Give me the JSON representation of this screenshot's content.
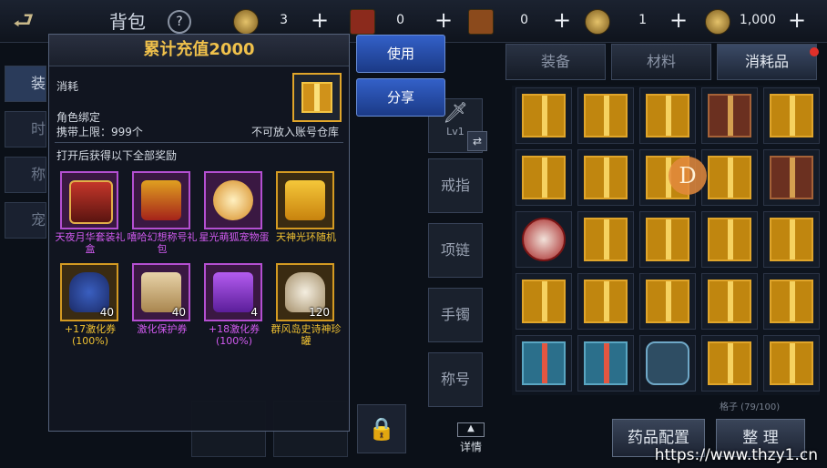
{
  "header": {
    "title": "背包",
    "currencies": [
      {
        "icon": "coin-icon",
        "value": "3"
      },
      {
        "icon": "scroll-icon",
        "value": "0"
      },
      {
        "icon": "ticket-icon",
        "value": "0"
      },
      {
        "icon": "gold-coin-icon",
        "value": "1"
      },
      {
        "icon": "gem-coin-icon",
        "value": "1,000"
      }
    ]
  },
  "inventory": {
    "tabs": [
      "装备",
      "材料",
      "消耗品"
    ],
    "active_tab": "消耗品",
    "slot_count": "格子 (79/100)",
    "badge": "D",
    "buttons": {
      "medicine": "药品配置",
      "sort": "整 理"
    }
  },
  "equipment_slots": [
    "戒指",
    "项链",
    "手镯",
    "称号"
  ],
  "weapon_slot_level": "Lv1",
  "detail_label": "详情",
  "popup": {
    "title": "累计充值2000",
    "type": "消耗",
    "binding": "角色绑定",
    "stack_limit": "携带上限：999个",
    "warehouse_note": "不可放入账号仓库",
    "rewards_heading": "打开后获得以下全部奖励",
    "rewards": [
      {
        "name": "天夜月华套装礼盒",
        "count": "",
        "rarity": "purple",
        "art": "chest"
      },
      {
        "name": "嘻哈幻想称号礼包",
        "count": "",
        "rarity": "purple",
        "art": "giftred"
      },
      {
        "name": "星光萌狐宠物蛋",
        "count": "",
        "rarity": "purple",
        "art": "egg"
      },
      {
        "name": "天神光环随机",
        "count": "",
        "rarity": "gold",
        "art": "giftgold"
      },
      {
        "name": "+17激化券(100%)",
        "count": "40",
        "rarity": "gold",
        "art": "vase"
      },
      {
        "name": "激化保护券",
        "count": "40",
        "rarity": "purple",
        "art": "scroll"
      },
      {
        "name": "+18激化券(100%)",
        "count": "4",
        "rarity": "purple",
        "art": "ticket"
      },
      {
        "name": "群风岛史诗神珍罐",
        "count": "120",
        "rarity": "gold",
        "art": "jar"
      }
    ]
  },
  "actions": {
    "use": "使用",
    "share": "分享"
  },
  "watermark": "https://www.thzy1.cn"
}
